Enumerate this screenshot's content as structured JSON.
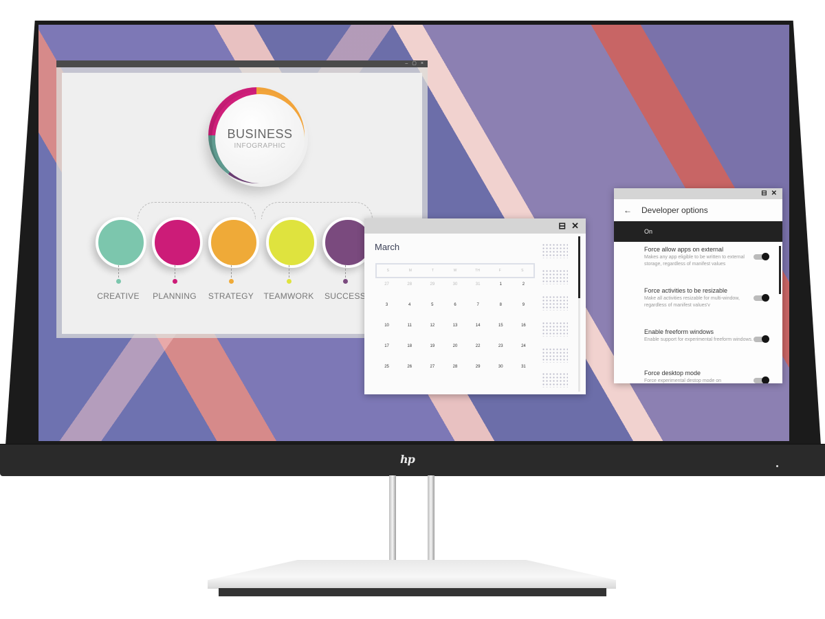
{
  "device": {
    "brand_logo": "hp",
    "type": "monitor"
  },
  "infographic_window": {
    "title_controls": [
      "minimize",
      "maximize",
      "close"
    ],
    "title_control_glyphs": [
      "–",
      "▢",
      "×"
    ],
    "hub_title": "BUSINESS",
    "hub_subtitle": "INFOGRAPHIC",
    "nodes": [
      {
        "label": "CREATIVE",
        "color": "#7cc6ad"
      },
      {
        "label": "PLANNING",
        "color": "#cc1c78"
      },
      {
        "label": "STRATEGY",
        "color": "#efaa38"
      },
      {
        "label": "TEAMWORK",
        "color": "#dfe33e"
      },
      {
        "label": "SUCCESS",
        "color": "#7a4a7e"
      }
    ]
  },
  "calendar_window": {
    "controls": {
      "snap_glyph": "⊟",
      "close_glyph": "✕"
    },
    "month": "March",
    "weekdays": [
      "S",
      "M",
      "T",
      "W",
      "TH",
      "F",
      "S"
    ],
    "weeks": [
      [
        {
          "d": "27",
          "muted": true
        },
        {
          "d": "28",
          "muted": true
        },
        {
          "d": "29",
          "muted": true
        },
        {
          "d": "30",
          "muted": true
        },
        {
          "d": "31",
          "muted": true
        },
        {
          "d": "1"
        },
        {
          "d": "2"
        }
      ],
      [
        {
          "d": "3"
        },
        {
          "d": "4"
        },
        {
          "d": "5"
        },
        {
          "d": "6"
        },
        {
          "d": "7"
        },
        {
          "d": "8"
        },
        {
          "d": "9"
        }
      ],
      [
        {
          "d": "10"
        },
        {
          "d": "11"
        },
        {
          "d": "12"
        },
        {
          "d": "13"
        },
        {
          "d": "14"
        },
        {
          "d": "15"
        },
        {
          "d": "16"
        }
      ],
      [
        {
          "d": "17"
        },
        {
          "d": "18"
        },
        {
          "d": "19"
        },
        {
          "d": "20"
        },
        {
          "d": "22"
        },
        {
          "d": "23"
        },
        {
          "d": "24"
        }
      ],
      [
        {
          "d": "25"
        },
        {
          "d": "26"
        },
        {
          "d": "27"
        },
        {
          "d": "28"
        },
        {
          "d": "29"
        },
        {
          "d": "30"
        },
        {
          "d": "31"
        }
      ]
    ]
  },
  "developer_window": {
    "controls": {
      "snap_glyph": "⊟",
      "close_glyph": "✕"
    },
    "back_glyph": "←",
    "title": "Developer options",
    "master_switch_label": "On",
    "items": [
      {
        "title": "Force allow apps on external",
        "description": "Makes any app eligible to be written to external storage, regardless of manifest values",
        "enabled": true
      },
      {
        "title": "Force activities to be resizable",
        "description": "Make all activities resizable for multi-window, regardless of manifest values'v",
        "enabled": true
      },
      {
        "title": "Enable freeform windows",
        "description": "Enable support for experimental freeform windows.",
        "enabled": true
      },
      {
        "title": "Force desktop mode",
        "description": "Force experimental destop mode on",
        "enabled": true
      }
    ]
  }
}
